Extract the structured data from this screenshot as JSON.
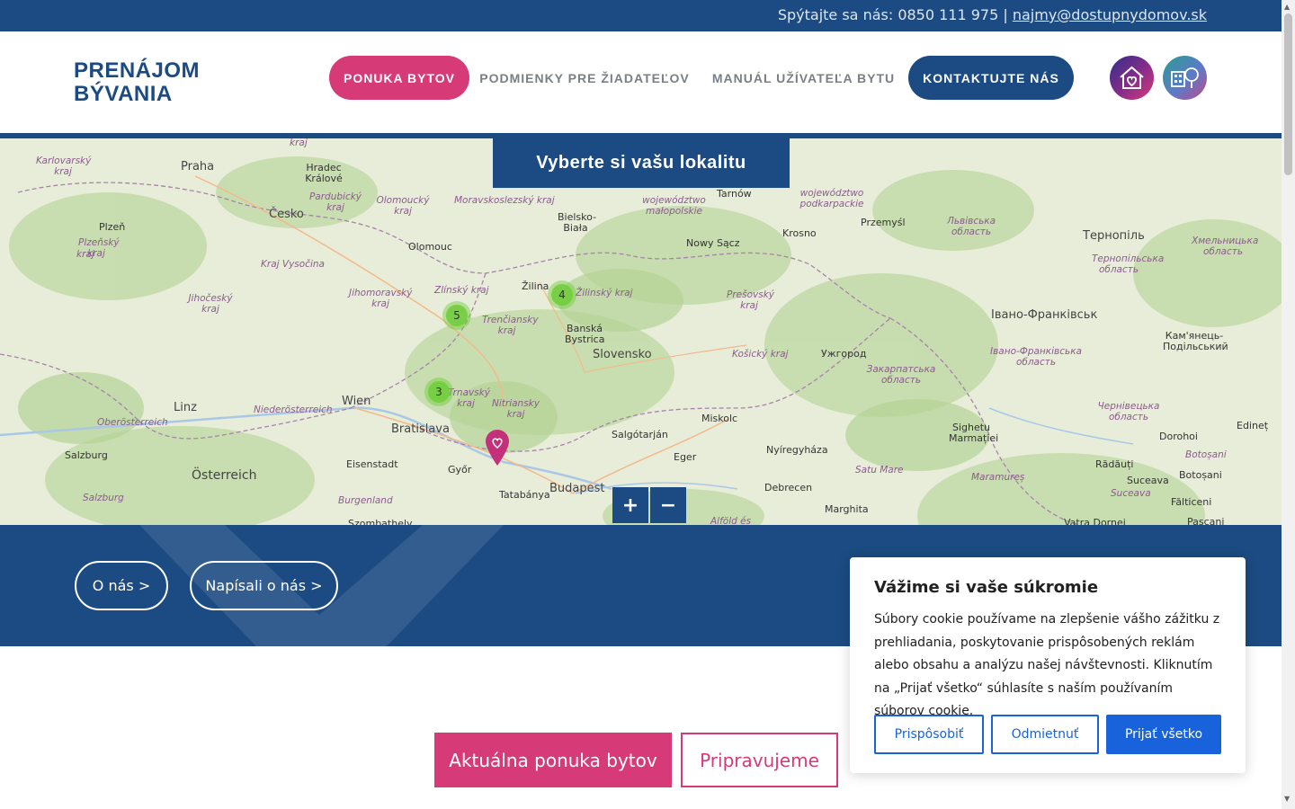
{
  "topbar": {
    "ask_text": "Spýtajte sa nás: 0850 111 975 | ",
    "email": "najmy@dostupnydomov.sk"
  },
  "header": {
    "logo_line1": "PRENÁJOM",
    "logo_line2": "BÝVANIA",
    "nav": {
      "offer": "PONUKA BYTOV",
      "conditions": "PODMIENKY PRE ŽIADATEĽOV",
      "manual": "MANUÁL UŽÍVATEĽA BYTU",
      "contact": "KONTAKTUJTE NÁS"
    },
    "icons": [
      "house-heart-icon",
      "building-tree-icon"
    ]
  },
  "map": {
    "title": "Vyberte si vašu lokalitu",
    "clusters": [
      {
        "count": "5"
      },
      {
        "count": "4"
      },
      {
        "count": "3"
      }
    ],
    "places": {
      "praha": "Praha",
      "hradec": "Hradec Králové",
      "cesko": "Česko",
      "olomouc": "Olomouc",
      "plzen": "Plzeň",
      "bielsko": "Bielsko-Biała",
      "tarnow": "Tarnów",
      "przemysl": "Przemyśl",
      "krosno": "Krosno",
      "nowy_sacz": "Nowy Sącz",
      "zilina": "Žilina",
      "banska": "Banská Bystrica",
      "slovensko": "Slovensko",
      "uzhorod": "Ужгород",
      "ternopil": "Тернопіль",
      "ivano": "Івано-Франківськ",
      "wien": "Wien",
      "linz": "Linz",
      "bratislava": "Bratislava",
      "salzburg": "Salzburg",
      "osterreich": "Österreich",
      "eisenstadt": "Eisenstadt",
      "gyor": "Győr",
      "tatabanya": "Tatabánya",
      "budapest": "Budapest",
      "miskolc": "Miskolc",
      "salgotarjan": "Salgótarján",
      "eger": "Eger",
      "nyiregyhaza": "Nyíregyháza",
      "debrecen": "Debrecen",
      "marghita": "Marghita",
      "sighetu": "Sighetu Marmației",
      "dorohoi": "Dorohoi",
      "radauti": "Rădăuți",
      "suceava": "Suceava",
      "botosani": "Botoșani",
      "falticeni": "Fălticeni",
      "edinet": "Edineț",
      "kamianets": "Кам'янець-Подільський",
      "pascani": "Pașcani",
      "vatra": "Vatra Dornei",
      "szombathely": "Szombathely"
    },
    "regions": {
      "karlovarsky": "Karlovarský kraj",
      "pardubicky": "Pardubický kraj",
      "olomoucky": "Olomoucký kraj",
      "moravskoslezsky": "Moravskoslezský kraj",
      "malopolskie": "województwo małopolskie",
      "podkarpackie": "województwo podkarpackie",
      "lvivska": "Львівська область",
      "ternopilska": "Тернопільська область",
      "khmelnytska": "Хмельницька область",
      "plzensky": "Plzeňský kraj",
      "vysocina": "Kraj Vysočina",
      "jihomoravsky": "Jihomoravský kraj",
      "zlinsky": "Zlínský kraj",
      "trenciansky": "Trenčiansky kraj",
      "zilinsky": "Žilinský kraj",
      "presovsky": "Prešovský kraj",
      "kosicky": "Košický kraj",
      "jihocesky": "Jihočeský kraj",
      "trnavsky": "Trnavský kraj",
      "nitriansky": "Nitriansky kraj",
      "zakarpatska": "Закарпатська область",
      "ivanofrankivska": "Івано-Франківська область",
      "chernivetska": "Чернівецька область",
      "oberosterreich": "Oberösterreich",
      "niederosterreich": "Niederösterreich",
      "burgenland": "Burgenland",
      "salzburg_r": "Salzburg",
      "satu_mare": "Satu Mare",
      "maramures": "Maramureș",
      "botosani_r": "Botoșani",
      "suceava_r": "Suceava",
      "alfold": "Alföld és",
      "kraj_top": "kraj",
      "kraj_left": "kraj"
    },
    "zoom_in": "+",
    "zoom_out": "−"
  },
  "band": {
    "about": "O nás >",
    "press": "Napísali o nás >"
  },
  "tabs": {
    "current": "Aktuálna ponuka bytov",
    "preparing": "Pripravujeme"
  },
  "cookie": {
    "title": "Vážime si vaše súkromie",
    "text": "Súbory cookie používame na zlepšenie vášho zážitku z prehliadania, poskytovanie prispôsobených reklám alebo obsahu a analýzu našej návštevnosti. Kliknutím na „Prijať všetko“ súhlasíte s naším používaním súborov cookie.",
    "customize": "Prispôsobiť",
    "reject": "Odmietnuť",
    "accept": "Prijať všetko"
  },
  "colors": {
    "brand_blue": "#1b4b82",
    "brand_pink": "#d63a77",
    "cookie_blue": "#1863dc",
    "cluster_green": "#6ecc39"
  }
}
